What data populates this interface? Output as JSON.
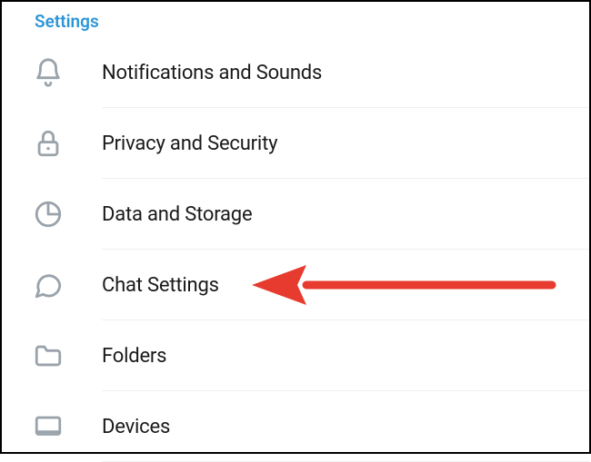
{
  "section_title": "Settings",
  "items": [
    {
      "id": "notifications",
      "label": "Notifications and Sounds",
      "icon": "bell-icon"
    },
    {
      "id": "privacy",
      "label": "Privacy and Security",
      "icon": "lock-icon"
    },
    {
      "id": "data",
      "label": "Data and Storage",
      "icon": "pie-chart-icon"
    },
    {
      "id": "chat",
      "label": "Chat Settings",
      "icon": "chat-bubble-icon"
    },
    {
      "id": "folders",
      "label": "Folders",
      "icon": "folder-icon"
    },
    {
      "id": "devices",
      "label": "Devices",
      "icon": "device-icon"
    }
  ],
  "annotation": {
    "target_item": "chat",
    "color": "#e63b2e"
  }
}
